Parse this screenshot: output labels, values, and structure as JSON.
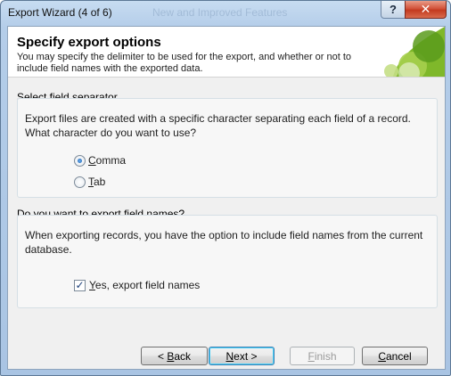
{
  "window": {
    "title": "Export Wizard (4 of 6)",
    "ghost_title": "New and Improved Features",
    "help_glyph": "?",
    "close_glyph": "✕"
  },
  "header": {
    "title": "Specify export options",
    "description": "You may specify the delimiter to be used for the export, and whether or not to include field names with the exported data."
  },
  "separator_group": {
    "label": "Select field separator",
    "text": "Export files are created with a specific character separating each field of a record. What character do you want to use?",
    "options": [
      {
        "label_first": "C",
        "label_rest": "omma",
        "selected": true
      },
      {
        "label_first": "T",
        "label_rest": "ab",
        "selected": false
      }
    ]
  },
  "field_names_group": {
    "label": "Do you want to export field names?",
    "text": "When exporting records, you have the option to include field names from the current database.",
    "checkbox": {
      "label_first": "Y",
      "label_rest": "es, export field names",
      "checked": true
    }
  },
  "buttons": {
    "back": {
      "prefix": "< ",
      "ul": "B",
      "rest": "ack"
    },
    "next": {
      "ul": "N",
      "rest": "ext >"
    },
    "finish": {
      "ul": "F",
      "rest": "inish"
    },
    "cancel": {
      "prefix": "",
      "ul": "C",
      "rest": "ancel"
    }
  },
  "colors": {
    "accent_green": "#7fb82a",
    "title_bar": "#b4cde9",
    "close_button": "#c33a1f"
  }
}
